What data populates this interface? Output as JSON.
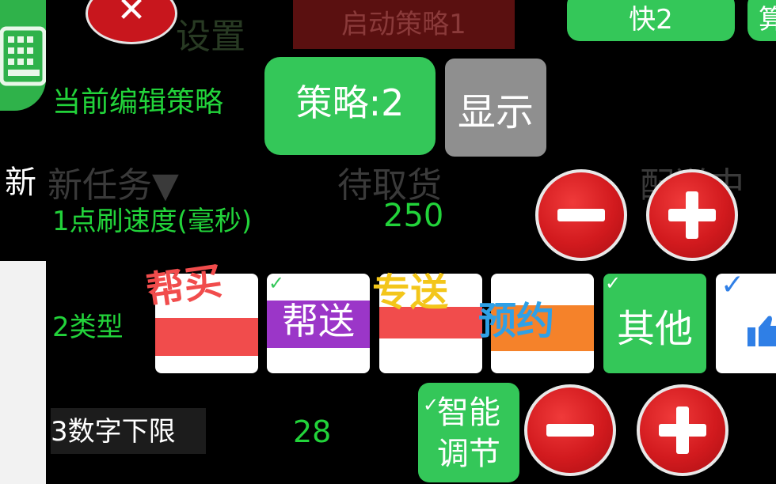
{
  "left_partial_char": "新",
  "background": {
    "settings_text": "设置",
    "new_task": "新任务▼",
    "pending_pickup": "待取货",
    "delivering_partial": "配送中"
  },
  "toolbar": {
    "close_glyph": "✕",
    "start_label": "启动策略1",
    "fast_label": "快2",
    "calc_partial": "算"
  },
  "editor": {
    "current_label": "当前编辑策略",
    "strategy_button": "策略:2",
    "show_button": "显示"
  },
  "speed": {
    "label": "1点刷速度(毫秒)",
    "value": "250"
  },
  "types": {
    "label": "2类型",
    "items": [
      {
        "key": "buy",
        "text": "",
        "checked": false
      },
      {
        "key": "send",
        "text": "帮送",
        "checked": true
      },
      {
        "key": "special",
        "text": "",
        "checked": false
      },
      {
        "key": "reserve",
        "text": "",
        "checked": false
      },
      {
        "key": "other",
        "text": "其他",
        "checked": true
      },
      {
        "key": "like",
        "text": "",
        "checked": true
      }
    ],
    "tag_buy": "帮买",
    "tag_special": "专送",
    "tag_reserve": "预约"
  },
  "lower_limit": {
    "label": "3数字下限",
    "value": "28",
    "smart_line1": "智能",
    "smart_line2": "调节"
  },
  "check_glyph": "✓",
  "colors": {
    "accent_green": "#34c759",
    "label_green": "#22d33a",
    "danger_red": "#d21a1e"
  },
  "icons": [
    "keyboard-icon",
    "close-icon",
    "minus-icon",
    "plus-icon",
    "check-icon",
    "thumbs-up-icon"
  ]
}
